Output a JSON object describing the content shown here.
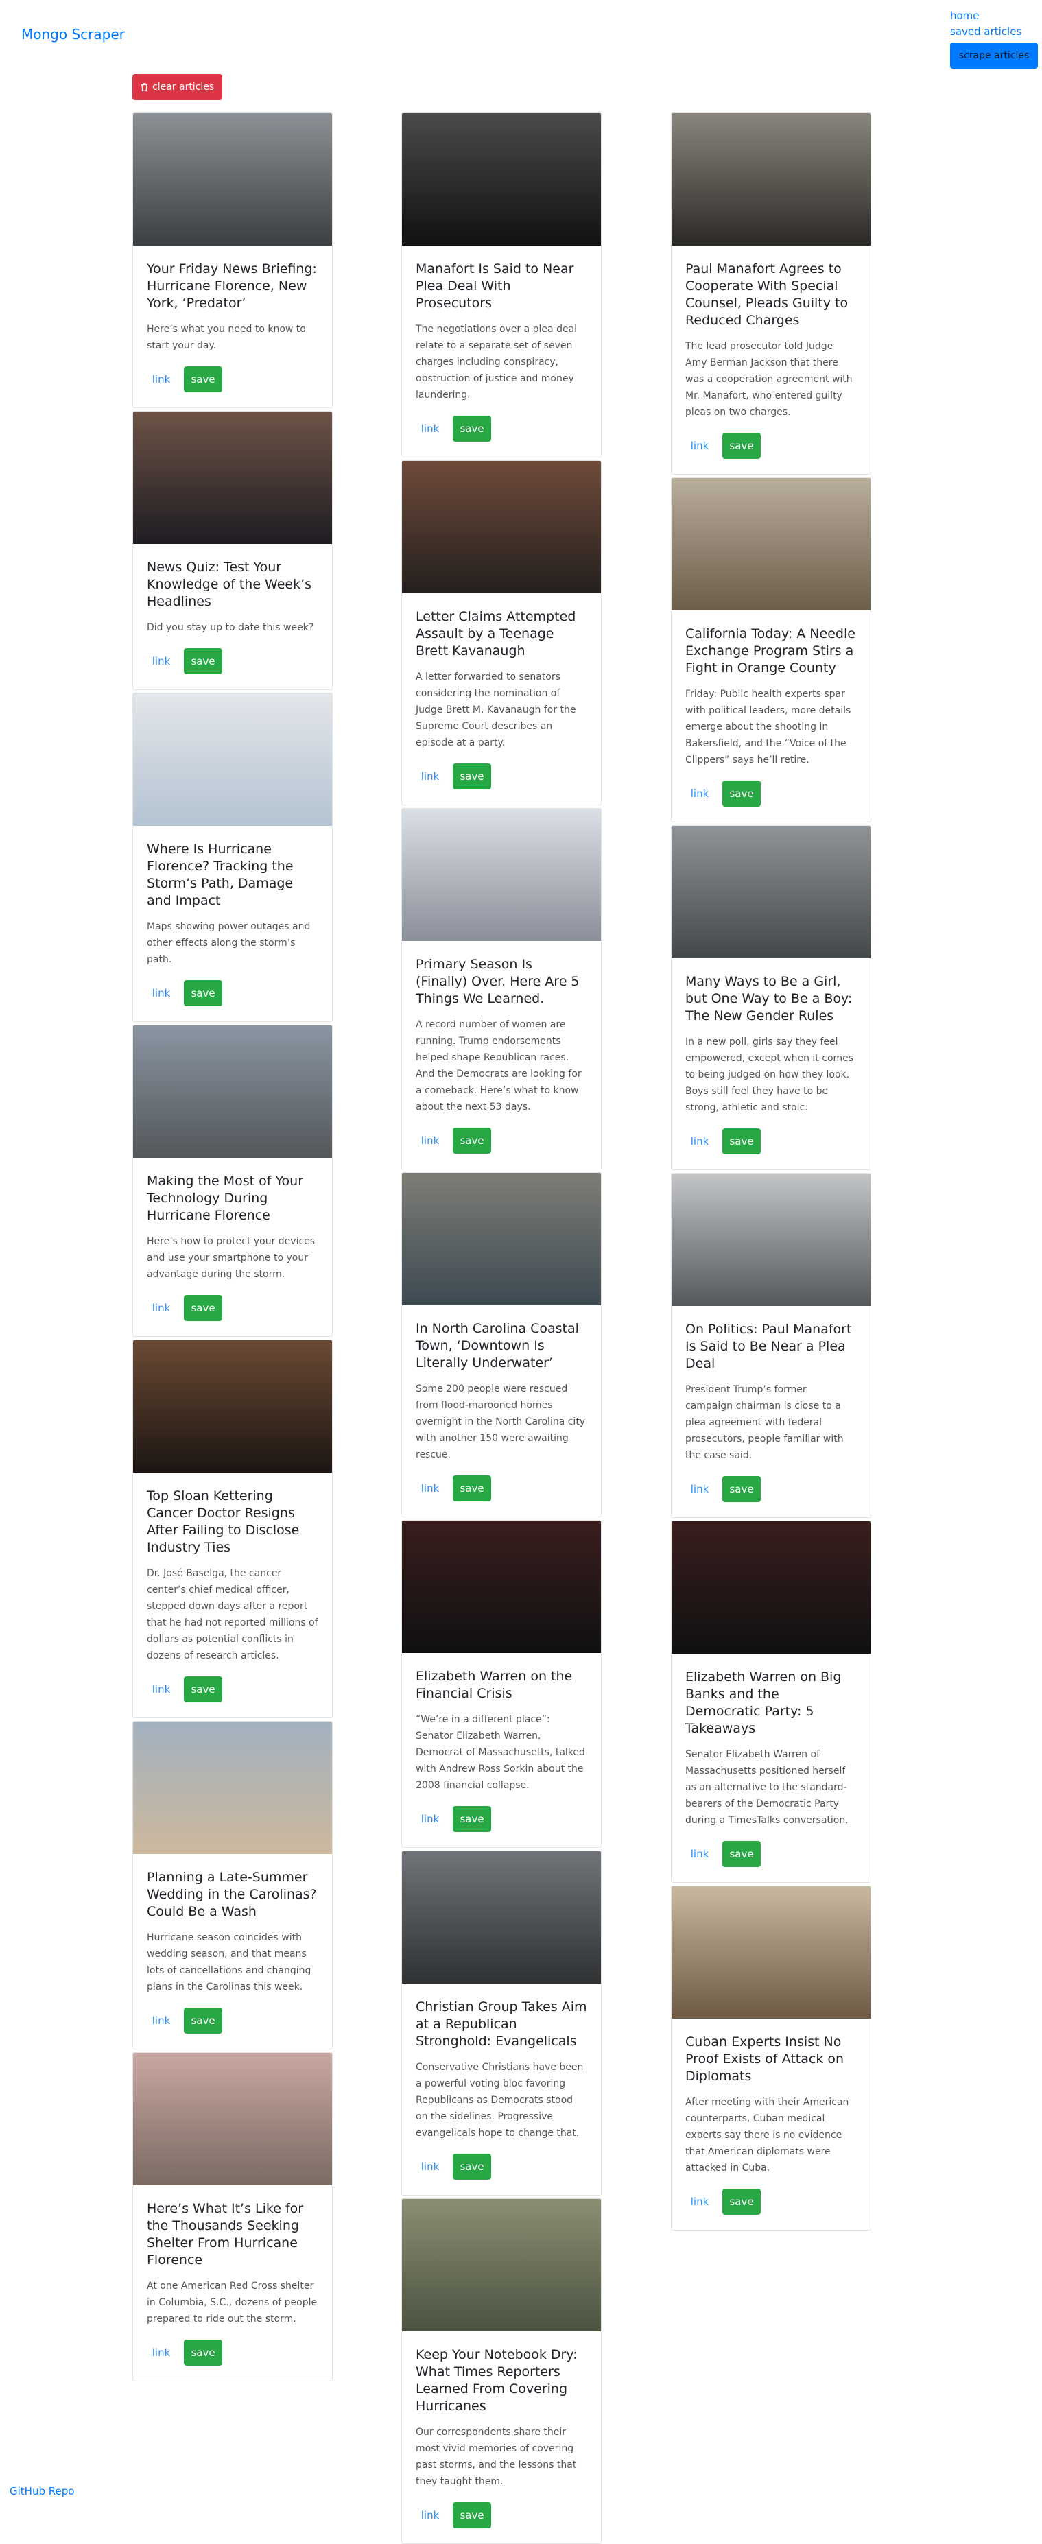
{
  "brand": "Mongo Scraper",
  "nav": {
    "home": "home",
    "saved": "saved articles",
    "scrape": "scrape articles"
  },
  "clear_label": "clear articles",
  "link_label": "link",
  "save_label": "save",
  "footer": "GitHub Repo",
  "articles": [
    {
      "title": "Your Friday News Briefing: Hurricane Florence, New York, ‘Predator’",
      "summary": "Here’s what you need to know to start your day."
    },
    {
      "title": "Manafort Is Said to Near Plea Deal With Prosecutors",
      "summary": "The negotiations over a plea deal relate to a separate set of seven charges including conspiracy, obstruction of justice and money laundering."
    },
    {
      "title": "Paul Manafort Agrees to Cooperate With Special Counsel, Pleads Guilty to Reduced Charges",
      "summary": "The lead prosecutor told Judge Amy Berman Jackson that there was a cooperation agreement with Mr. Manafort, who entered guilty pleas on two charges."
    },
    {
      "title": "News Quiz: Test Your Knowledge of the Week’s Headlines",
      "summary": "Did you stay up to date this week?"
    },
    {
      "title": "Letter Claims Attempted Assault by a Teenage Brett Kavanaugh",
      "summary": "A letter forwarded to senators considering the nomination of Judge Brett M. Kavanaugh for the Supreme Court describes an episode at a party."
    },
    {
      "title": "California Today: A Needle Exchange Program Stirs a Fight in Orange County",
      "summary": "Friday: Public health experts spar with political leaders, more details emerge about the shooting in Bakersfield, and the “Voice of the Clippers” says he’ll retire."
    },
    {
      "title": "Where Is Hurricane Florence? Tracking the Storm’s Path, Damage and Impact",
      "summary": "Maps showing power outages and other effects along the storm’s path."
    },
    {
      "title": "Primary Season Is (Finally) Over. Here Are 5 Things We Learned.",
      "summary": "A record number of women are running. Trump endorsements helped shape Republican races. And the Democrats are looking for a comeback. Here’s what to know about the next 53 days."
    },
    {
      "title": "Many Ways to Be a Girl, but One Way to Be a Boy: The New Gender Rules",
      "summary": "In a new poll, girls say they feel empowered, except when it comes to being judged on how they look. Boys still feel they have to be strong, athletic and stoic."
    },
    {
      "title": "Making the Most of Your Technology During Hurricane Florence",
      "summary": "Here’s how to protect your devices and use your smartphone to your advantage during the storm."
    },
    {
      "title": "In North Carolina Coastal Town, ‘Downtown Is Literally Underwater’",
      "summary": "Some 200 people were rescued from flood-marooned homes overnight in the North Carolina city with another 150 were awaiting rescue."
    },
    {
      "title": "On Politics: Paul Manafort Is Said to Be Near a Plea Deal",
      "summary": "President Trump’s former campaign chairman is close to a plea agreement with federal prosecutors, people familiar with the case said."
    },
    {
      "title": "Top Sloan Kettering Cancer Doctor Resigns After Failing to Disclose Industry Ties",
      "summary": "Dr. José Baselga, the cancer center’s chief medical officer, stepped down days after a report that he had not reported millions of dollars as potential conflicts in dozens of research articles."
    },
    {
      "title": "Elizabeth Warren on the Financial Crisis",
      "summary": "“We’re in a different place”: Senator Elizabeth Warren, Democrat of Massachusetts, talked with Andrew Ross Sorkin about the 2008 financial collapse."
    },
    {
      "title": "Elizabeth Warren on Big Banks and the Democratic Party: 5 Takeaways",
      "summary": "Senator Elizabeth Warren of Massachusetts positioned herself as an alternative to the standard-bearers of the Democratic Party during a TimesTalks conversation."
    },
    {
      "title": "Planning a Late-Summer Wedding in the Carolinas? Could Be a Wash",
      "summary": "Hurricane season coincides with wedding season, and that means lots of cancellations and changing plans in the Carolinas this week."
    },
    {
      "title": "Christian Group Takes Aim at a Republican Stronghold: Evangelicals",
      "summary": "Conservative Christians have been a powerful voting bloc favoring Republicans as Democrats stood on the sidelines. Progressive evangelicals hope to change that."
    },
    {
      "title": "Cuban Experts Insist No Proof Exists of Attack on Diplomats",
      "summary": "After meeting with their American counterparts, Cuban medical experts say there is no evidence that American diplomats were attacked in Cuba."
    },
    {
      "title": "Here’s What It’s Like for the Thousands Seeking Shelter From Hurricane Florence",
      "summary": "At one American Red Cross shelter in Columbia, S.C., dozens of people prepared to ride out the storm."
    },
    {
      "title": "Keep Your Notebook Dry: What Times Reporters Learned From Covering Hurricanes",
      "summary": "Our correspondents share their most vivid memories of covering past storms, and the lessons that they taught them."
    }
  ]
}
